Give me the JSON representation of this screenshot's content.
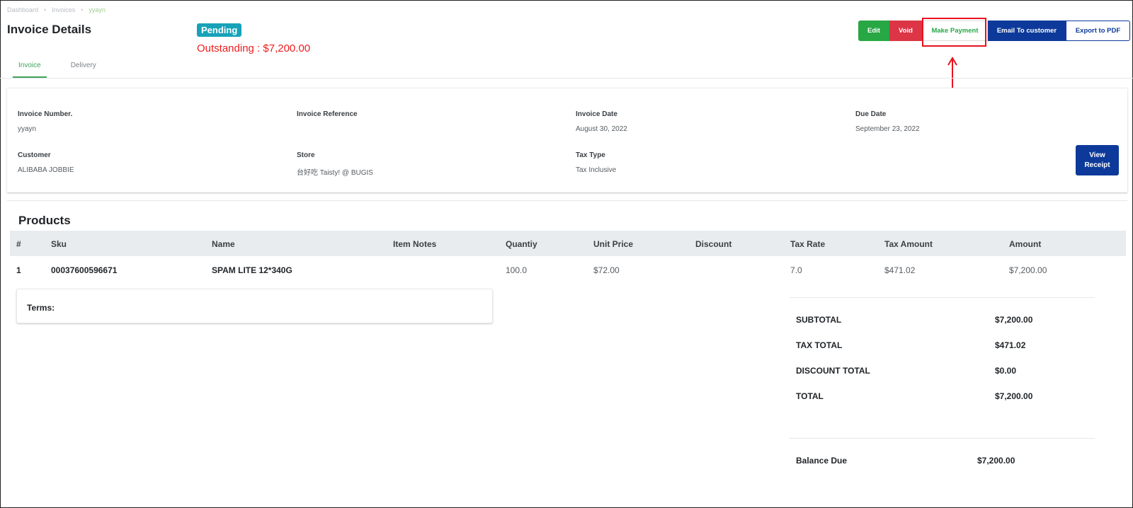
{
  "breadcrumb": {
    "items": [
      "Dashboard",
      "Invoices"
    ],
    "current": "yyayn",
    "separator": "•"
  },
  "header": {
    "title": "Invoice Details",
    "status": "Pending",
    "outstanding": "Outstanding : $7,200.00"
  },
  "actions": {
    "edit": "Edit",
    "void": "Void",
    "make_payment": "Make Payment",
    "email": "Email To customer",
    "export": "Export to PDF"
  },
  "tabs": [
    {
      "label": "Invoice"
    },
    {
      "label": "Delivery"
    }
  ],
  "info": {
    "invoice_number": {
      "label": "Invoice Number.",
      "value": "yyayn"
    },
    "invoice_reference": {
      "label": "Invoice Reference",
      "value": ""
    },
    "invoice_date": {
      "label": "Invoice Date",
      "value": "August 30, 2022"
    },
    "due_date": {
      "label": "Due Date",
      "value": "September 23, 2022"
    },
    "customer": {
      "label": "Customer",
      "value": "ALIBABA JOBBIE"
    },
    "store": {
      "label": "Store",
      "value": "台好吃 Taisty! @ BUGIS"
    },
    "tax_type": {
      "label": "Tax Type",
      "value": "Tax Inclusive"
    },
    "view_receipt_line1": "View",
    "view_receipt_line2": "Receipt"
  },
  "products": {
    "title": "Products",
    "columns": [
      "#",
      "Sku",
      "Name",
      "Item Notes",
      "Quantiy",
      "Unit Price",
      "Discount",
      "Tax Rate",
      "Tax Amount",
      "Amount"
    ],
    "rows": [
      {
        "num": "1",
        "sku": "00037600596671",
        "name": "SPAM LITE 12*340G",
        "notes": "",
        "quantity": "100.0",
        "unit_price": "$72.00",
        "discount": "",
        "tax_rate": "7.0",
        "tax_amount": "$471.02",
        "amount": "$7,200.00"
      }
    ]
  },
  "terms": {
    "label": "Terms:"
  },
  "totals": {
    "subtotal": {
      "label": "SUBTOTAL",
      "value": "$7,200.00"
    },
    "tax_total": {
      "label": "TAX TOTAL",
      "value": "$471.02"
    },
    "discount_total": {
      "label": "DISCOUNT TOTAL",
      "value": "$0.00"
    },
    "total": {
      "label": "TOTAL",
      "value": "$7,200.00"
    },
    "balance_due": {
      "label": "Balance Due",
      "value": "$7,200.00"
    }
  },
  "colors": {
    "annotation": "#e8121f",
    "accent_green": "#28a745",
    "accent_blue": "#0d3a9a",
    "status": "#17a2b8"
  }
}
